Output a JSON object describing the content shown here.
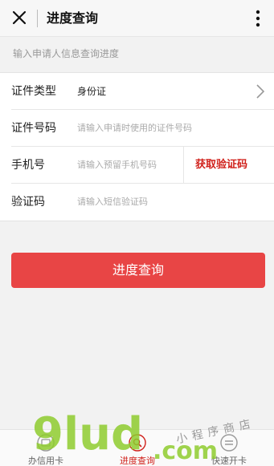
{
  "header": {
    "title": "进度查询"
  },
  "hint": "输入申请人信息查询进度",
  "form": {
    "id_type": {
      "label": "证件类型",
      "value": "身份证"
    },
    "id_number": {
      "label": "证件号码",
      "placeholder": "请输入申请时使用的证件号码"
    },
    "phone": {
      "label": "手机号",
      "placeholder": "请输入预留手机号码",
      "get_code": "获取验证码"
    },
    "sms_code": {
      "label": "验证码",
      "placeholder": "请输入短信验证码"
    }
  },
  "submit_label": "进度查询",
  "tabs": [
    {
      "label": "办信用卡",
      "icon": "card-icon",
      "active": false
    },
    {
      "label": "进度查询",
      "icon": "search-icon",
      "active": true
    },
    {
      "label": "快速开卡",
      "icon": "card-open-icon",
      "active": false
    }
  ],
  "watermark": {
    "brand": "9lud",
    "domain": ".com",
    "caption": "小程序商店"
  },
  "colors": {
    "accent": "#e84545",
    "link_red": "#d0201a"
  }
}
